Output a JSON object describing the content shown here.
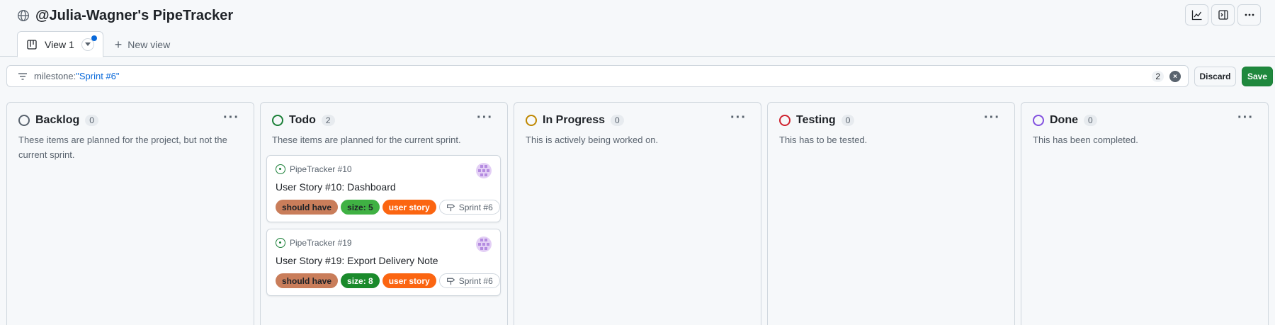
{
  "project": {
    "title": "@Julia-Wagner's PipeTracker"
  },
  "tabs": {
    "active_label": "View 1",
    "new_view_label": "New view"
  },
  "filter": {
    "key": "milestone:",
    "value": "\"Sprint #6\"",
    "count": "2"
  },
  "actions": {
    "discard_label": "Discard",
    "save_label": "Save"
  },
  "columns": [
    {
      "name": "Backlog",
      "count": "0",
      "color": "#59636e",
      "description": "These items are planned for the project, but not the current sprint.",
      "cards": []
    },
    {
      "name": "Todo",
      "count": "2",
      "color": "#1a7f37",
      "description": "These items are planned for the current sprint.",
      "cards": [
        {
          "ref": "PipeTracker #10",
          "title": "User Story #10: Dashboard",
          "labels": [
            "should have",
            "size: 5",
            "user story"
          ],
          "milestone": "Sprint #6"
        },
        {
          "ref": "PipeTracker #19",
          "title": "User Story #19: Export Delivery Note",
          "labels": [
            "should have",
            "size: 8",
            "user story"
          ],
          "milestone": "Sprint #6"
        }
      ]
    },
    {
      "name": "In Progress",
      "count": "0",
      "color": "#bf8700",
      "description": "This is actively being worked on.",
      "cards": []
    },
    {
      "name": "Testing",
      "count": "0",
      "color": "#cf222e",
      "description": "This has to be tested.",
      "cards": []
    },
    {
      "name": "Done",
      "count": "0",
      "color": "#8250df",
      "description": "This has been completed.",
      "cards": []
    }
  ],
  "icons": {
    "title_icon": "globe-icon",
    "tab_icon": "board-icon",
    "toolbar": [
      "insights-icon",
      "sidebar-panel-icon",
      "kebab-horizontal-icon"
    ]
  }
}
